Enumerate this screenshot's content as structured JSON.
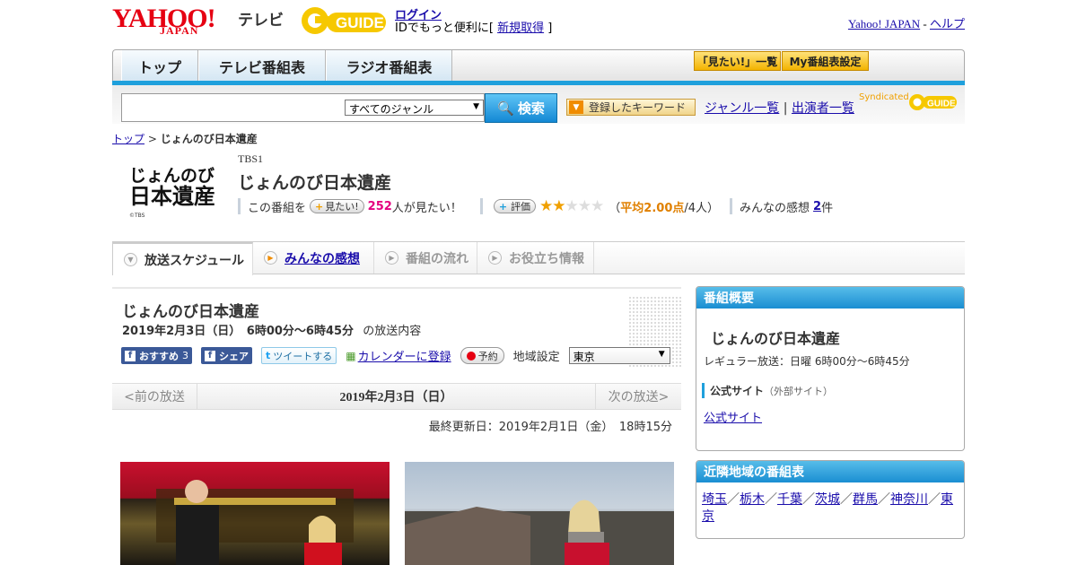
{
  "header": {
    "yahoo_logo": "YAHOO!",
    "japan_logo": "JAPAN",
    "tv_label": "テレビ",
    "gguide_logo": "GUIDE",
    "login": "ログイン",
    "login_sub_prefix": "IDでもっと便利に[",
    "signup": "新規取得",
    "login_sub_suffix": "]",
    "yahoo_japan_link": "Yahoo! JAPAN",
    "dash": "-",
    "help_link": "ヘルプ"
  },
  "nav": {
    "tabs": [
      "トップ",
      "テレビ番組表",
      "ラジオ番組表"
    ],
    "mitai_list": "「見たい!」一覧",
    "my_schedule": "My番組表設定"
  },
  "search": {
    "genre_selected": "すべてのジャンル",
    "button": "検索",
    "keyword_button": "登録したキーワード",
    "genre_list": "ジャンル一覧",
    "divider": "|",
    "cast_list": "出演者一覧",
    "syndicated": "Syndicated"
  },
  "breadcrumb": {
    "top": "トップ",
    "sep": ">",
    "current": "じょんのび日本遺産"
  },
  "program": {
    "logo_line1": "じょんのび",
    "logo_line2": "日本遺産",
    "logo_copy": "©TBS",
    "channel": "TBS1",
    "title": "じょんのび日本遺産",
    "mitai_prefix": "この番組を",
    "mitai_button": "見たい!",
    "mitai_count": "252",
    "mitai_suffix": "人が見たい！",
    "rating_button": "評価",
    "rating": 2,
    "rating_max": 5,
    "avg_open": "（",
    "avg_label": "平均2.00点",
    "avg_count": "/4人）",
    "impressions_label": "みんなの感想",
    "impressions_count": "2",
    "impressions_unit": "件"
  },
  "tabs": [
    {
      "label": "放送スケジュール"
    },
    {
      "label": "みんなの感想"
    },
    {
      "label": "番組の流れ"
    },
    {
      "label": "お役立ち情報"
    }
  ],
  "broadcast": {
    "title": "じょんのび日本遺産",
    "date_time": "2019年2月3日（日）　6時00分～6時45分",
    "suffix": "の放送内容",
    "recommend": "おすすめ",
    "recommend_count": "3",
    "share": "シェア",
    "tweet": "ツイートする",
    "calendar": "カレンダーに登録",
    "reserve": "予約",
    "region_label": "地域設定",
    "region_value": "東京",
    "prev": "<前の放送",
    "current_date": "2019年2月3日（日）",
    "next": "次の放送>",
    "updated": "最終更新日：2019年2月1日（金）　18時15分"
  },
  "sidebar": {
    "overview_head": "番組概要",
    "overview_title": "じょんのび日本遺産",
    "regular": "レギュラー放送：日曜 6時00分～6時45分",
    "official_label": "公式サイト",
    "official_note": "（外部サイト）",
    "official_link": "公式サイト",
    "nearby_head": "近隣地域の番組表",
    "nearby": [
      "埼玉",
      "栃木",
      "千葉",
      "茨城",
      "群馬",
      "神奈川",
      "東京"
    ],
    "nearby_sep": "／"
  },
  "colors": {
    "yahoo_red": "#e60012",
    "accent_blue": "#1fa0dc",
    "gold": "#f3b300",
    "pink": "#e4007f"
  }
}
